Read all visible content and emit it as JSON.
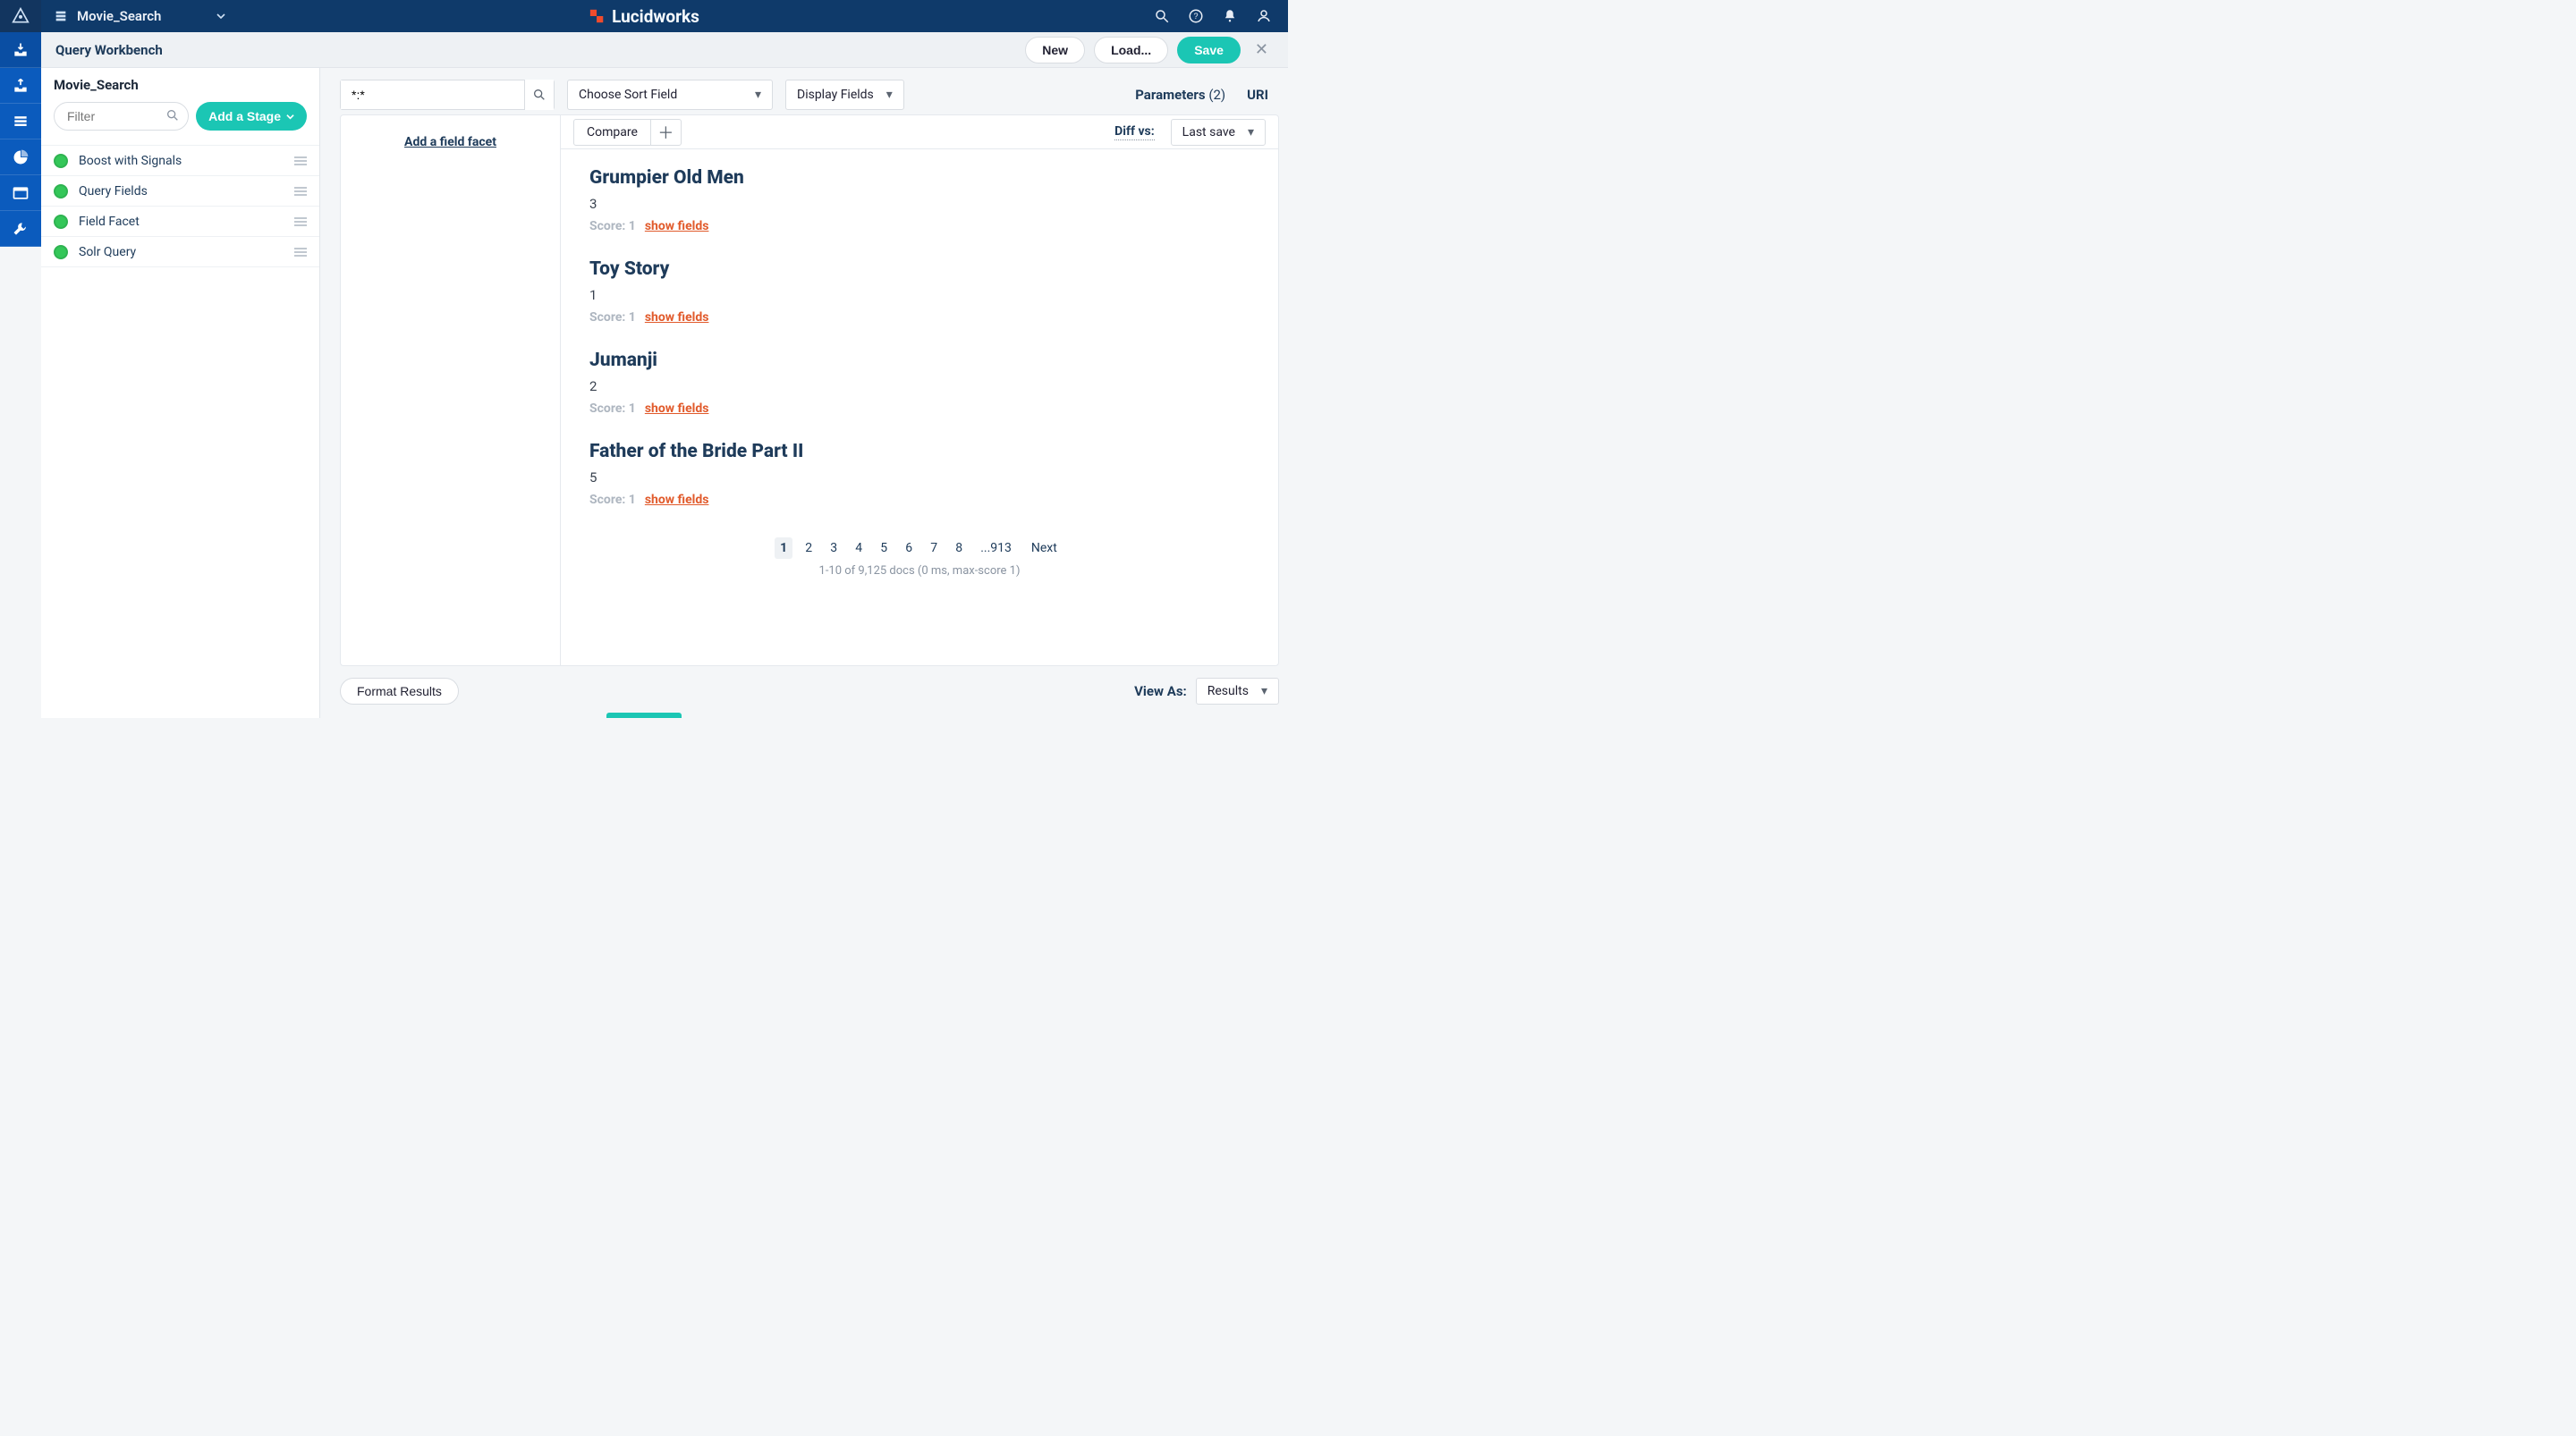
{
  "topbar": {
    "app_name": "Movie_Search",
    "brand": "Lucidworks"
  },
  "rail": {
    "items": [
      "ingest-icon",
      "index-out-icon",
      "collections-icon",
      "analytics-icon",
      "app-icon",
      "tools-icon"
    ]
  },
  "wbHeader": {
    "title": "Query Workbench",
    "new": "New",
    "load": "Load...",
    "save": "Save"
  },
  "pipeline": {
    "name": "Movie_Search",
    "filter_placeholder": "Filter",
    "add_stage": "Add a Stage",
    "stages": [
      "Boost with Signals",
      "Query Fields",
      "Field Facet",
      "Solr Query"
    ]
  },
  "toolbar": {
    "query_value": "*:*",
    "sort_label": "Choose Sort Field",
    "display_label": "Display Fields",
    "parameters_label": "Parameters",
    "parameters_count": "(2)",
    "uri": "URI"
  },
  "facets": {
    "add": "Add a field facet"
  },
  "results": {
    "compare": "Compare",
    "diff_label": "Diff vs:",
    "last_save": "Last save",
    "docs": [
      {
        "title": "Grumpier Old Men",
        "id": "3",
        "score": "Score: 1",
        "show": "show fields"
      },
      {
        "title": "Toy Story",
        "id": "1",
        "score": "Score: 1",
        "show": "show fields"
      },
      {
        "title": "Jumanji",
        "id": "2",
        "score": "Score: 1",
        "show": "show fields"
      },
      {
        "title": "Father of the Bride Part II",
        "id": "5",
        "score": "Score: 1",
        "show": "show fields"
      }
    ],
    "pages": [
      "1",
      "2",
      "3",
      "4",
      "5",
      "6",
      "7",
      "8"
    ],
    "ellipsis": "...913",
    "next": "Next",
    "summary": "1-10 of 9,125 docs (0 ms, max-score 1)"
  },
  "bottom": {
    "format": "Format Results",
    "view_as": "View As:",
    "mode": "Results"
  }
}
